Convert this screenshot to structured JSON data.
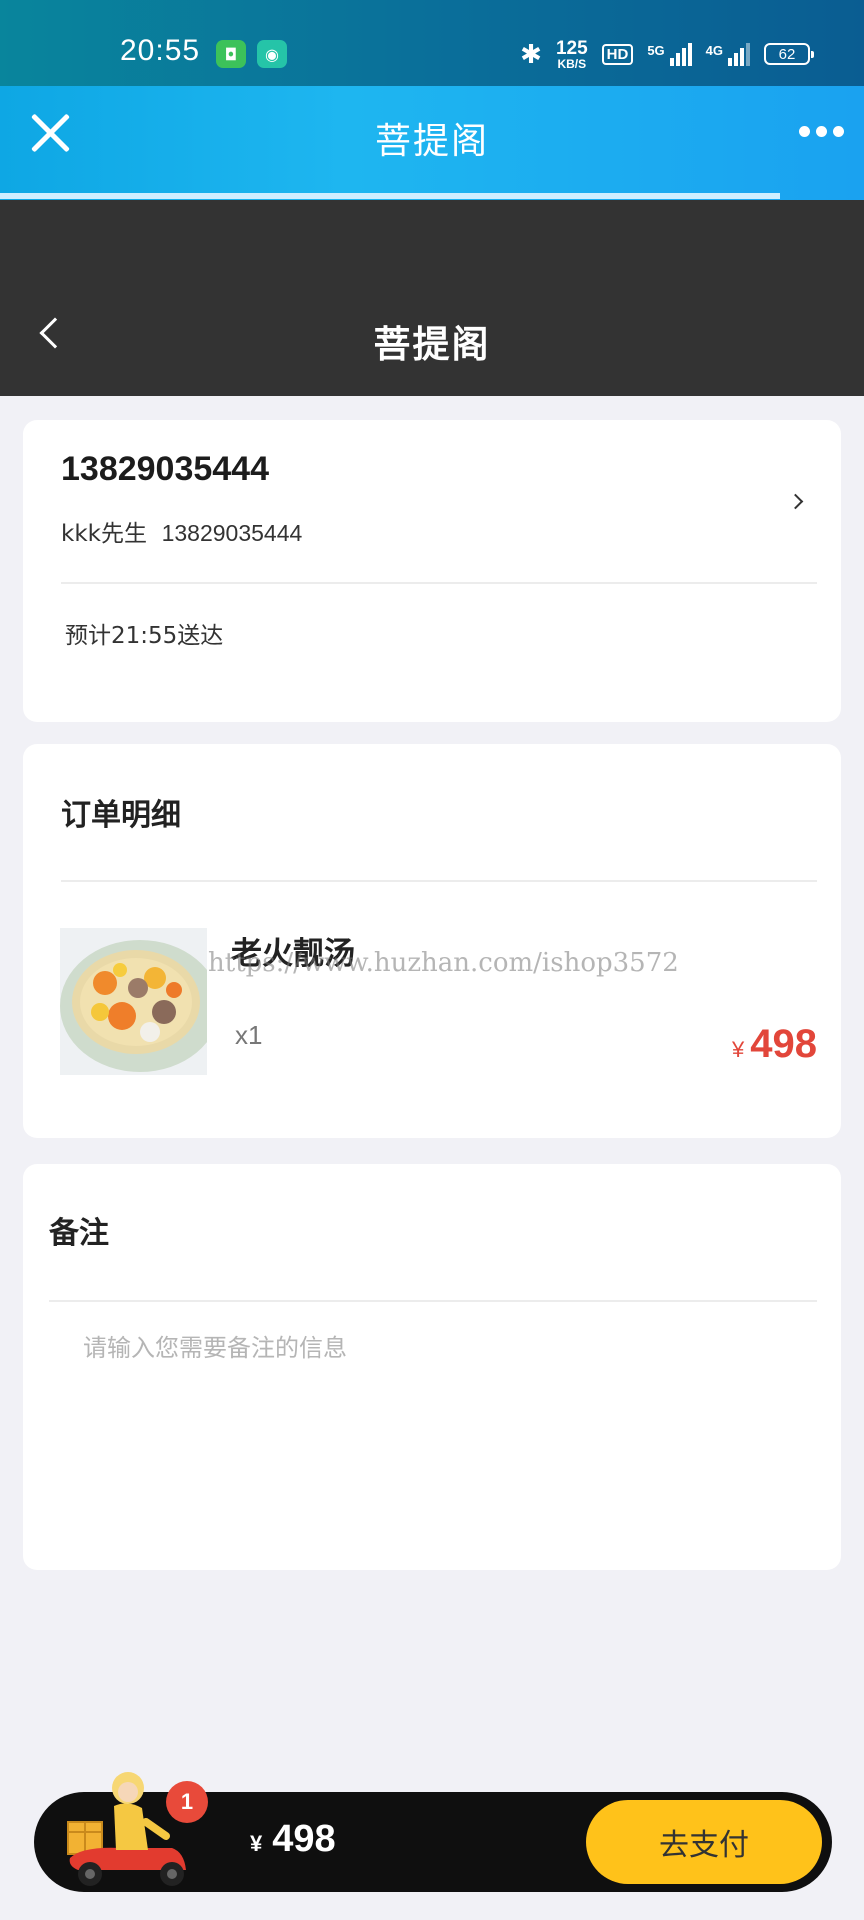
{
  "status_bar": {
    "time": "20:55",
    "speed_value": "125",
    "speed_unit": "KB/S",
    "hd_label": "HD",
    "net1_label": "5G",
    "net2_label": "4G",
    "battery": "62"
  },
  "miniprogram_bar": {
    "title": "菩提阁"
  },
  "page_header": {
    "title": "菩提阁"
  },
  "address": {
    "phone": "13829035444",
    "contact_name": "kkk先生",
    "contact_phone": "13829035444",
    "eta": "预计21:55送达"
  },
  "order": {
    "title": "订单明细",
    "items": [
      {
        "name": "老火靓汤",
        "qty": "x1",
        "currency": "¥",
        "price": "498"
      }
    ]
  },
  "watermark": "https://www.huzhan.com/ishop3572",
  "notes": {
    "title": "备注",
    "placeholder": "请输入您需要备注的信息"
  },
  "cart": {
    "badge_count": "1",
    "currency": "¥",
    "total": "498",
    "pay_label": "去支付"
  },
  "colors": {
    "header_dark": "#333333",
    "price_red": "#e2463a",
    "pay_yellow": "#ffc21a",
    "titlebar_blue": "#1eb6f0"
  }
}
